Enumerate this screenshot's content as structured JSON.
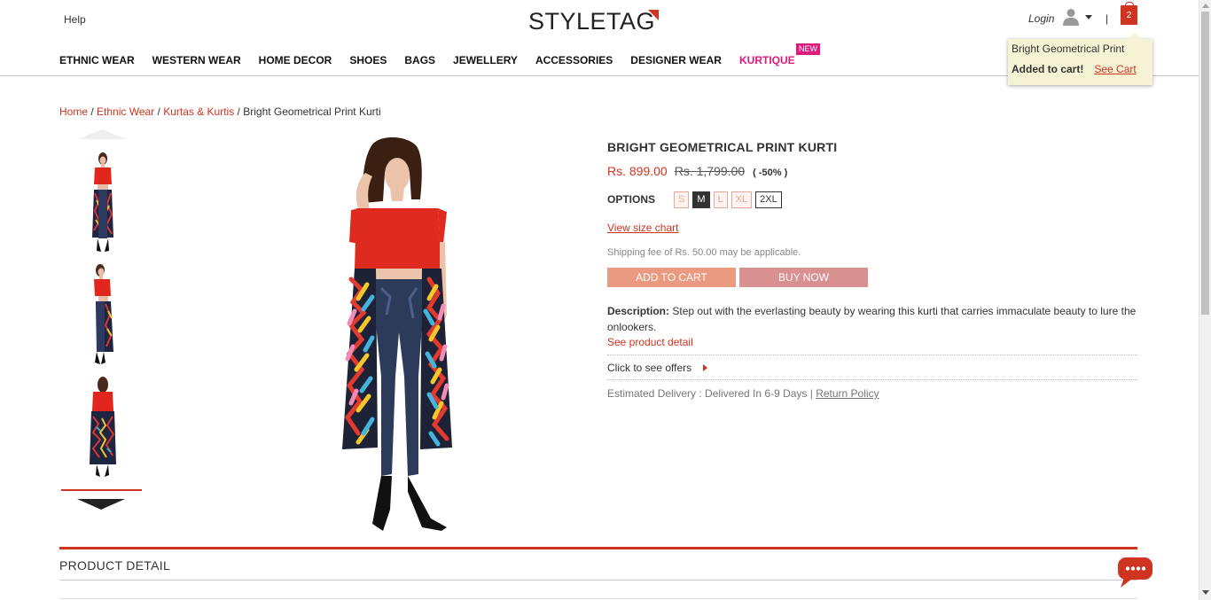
{
  "header": {
    "help_label": "Help",
    "logo_text": "STYLETAG",
    "login_label": "Login",
    "separator": "|",
    "cart_count": "2"
  },
  "nav": {
    "items": [
      {
        "label": "ETHNIC WEAR"
      },
      {
        "label": "WESTERN WEAR"
      },
      {
        "label": "HOME DECOR"
      },
      {
        "label": "SHOES"
      },
      {
        "label": "BAGS"
      },
      {
        "label": "JEWELLERY"
      },
      {
        "label": "ACCESSORIES"
      },
      {
        "label": "DESIGNER WEAR"
      },
      {
        "label": "KURTIQUE"
      }
    ],
    "new_badge": "NEW"
  },
  "cart_popover": {
    "product_name": "Bright Geometrical Print",
    "added_text": "Added to cart!",
    "see_cart_label": "See Cart"
  },
  "breadcrumb": {
    "home": "Home",
    "ethnic": "Ethnic Wear",
    "kurtas": "Kurtas & Kurtis",
    "current": "Bright Geometrical Print Kurti",
    "sep": " / "
  },
  "product": {
    "title": "BRIGHT GEOMETRICAL PRINT KURTI",
    "price": "Rs. 899.00",
    "mrp": "Rs. 1,799.00",
    "discount": "( -50% )",
    "options_label": "OPTIONS",
    "sizes": [
      {
        "label": "S",
        "state": "disabled"
      },
      {
        "label": "M",
        "state": "selected"
      },
      {
        "label": "L",
        "state": "disabled"
      },
      {
        "label": "XL",
        "state": "disabled"
      },
      {
        "label": "2XL",
        "state": "available"
      }
    ],
    "size_chart_label": "View size chart",
    "shipping_note": "Shipping fee of Rs. 50.00 may be applicable.",
    "add_to_cart_label": "ADD TO CART",
    "buy_now_label": "BUY NOW",
    "description_label": "Description:",
    "description_text": " Step out with the everlasting beauty by wearing this kurti that carries immaculate beauty to lure the onlookers.",
    "see_detail_label": "See product detail",
    "offers_label": "Click to see offers",
    "delivery_text": "Estimated Delivery : Delivered In 6-9 Days | ",
    "return_policy_label": "Return Policy"
  },
  "product_detail": {
    "heading": "PRODUCT DETAIL"
  },
  "colors": {
    "accent": "#d0331f",
    "kurtique": "#e0197e"
  }
}
